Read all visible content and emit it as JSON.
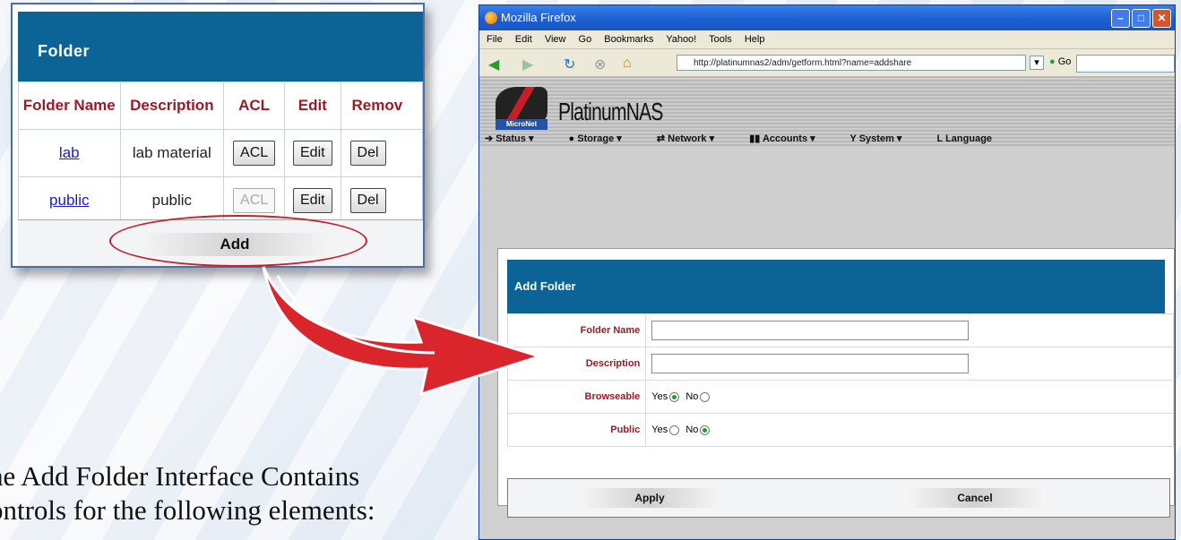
{
  "folder_panel": {
    "title": "Folder",
    "columns": [
      "Folder Name",
      "Description",
      "ACL",
      "Edit",
      "Remov"
    ],
    "rows": [
      {
        "name": "lab",
        "description": "lab material",
        "acl": "ACL",
        "edit": "Edit",
        "remove": "Del"
      },
      {
        "name": "public",
        "description": "public",
        "acl": "ACL",
        "edit": "Edit",
        "remove": "Del"
      }
    ],
    "add_label": "Add"
  },
  "caption": {
    "line1": "he Add Folder Interface Contains",
    "line2": "ontrols for the following elements:"
  },
  "browser": {
    "title": "Mozilla Firefox",
    "menu": [
      "File",
      "Edit",
      "View",
      "Go",
      "Bookmarks",
      "Yahoo!",
      "Tools",
      "Help"
    ],
    "url": "http://platinumnas2/adm/getform.html?name=addshare",
    "go_label": "Go"
  },
  "nas": {
    "brand": "PlatinumNAS",
    "badge": "MicroNet",
    "nav": [
      "Status ▾",
      "Storage ▾",
      "Network ▾",
      "Accounts ▾",
      "System ▾",
      "Language"
    ]
  },
  "add_folder": {
    "title": "Add Folder",
    "fields": {
      "folder_name_label": "Folder Name",
      "description_label": "Description",
      "browseable_label": "Browseable",
      "public_label": "Public"
    },
    "yes": "Yes",
    "no": "No",
    "apply_label": "Apply",
    "cancel_label": "Cancel"
  }
}
